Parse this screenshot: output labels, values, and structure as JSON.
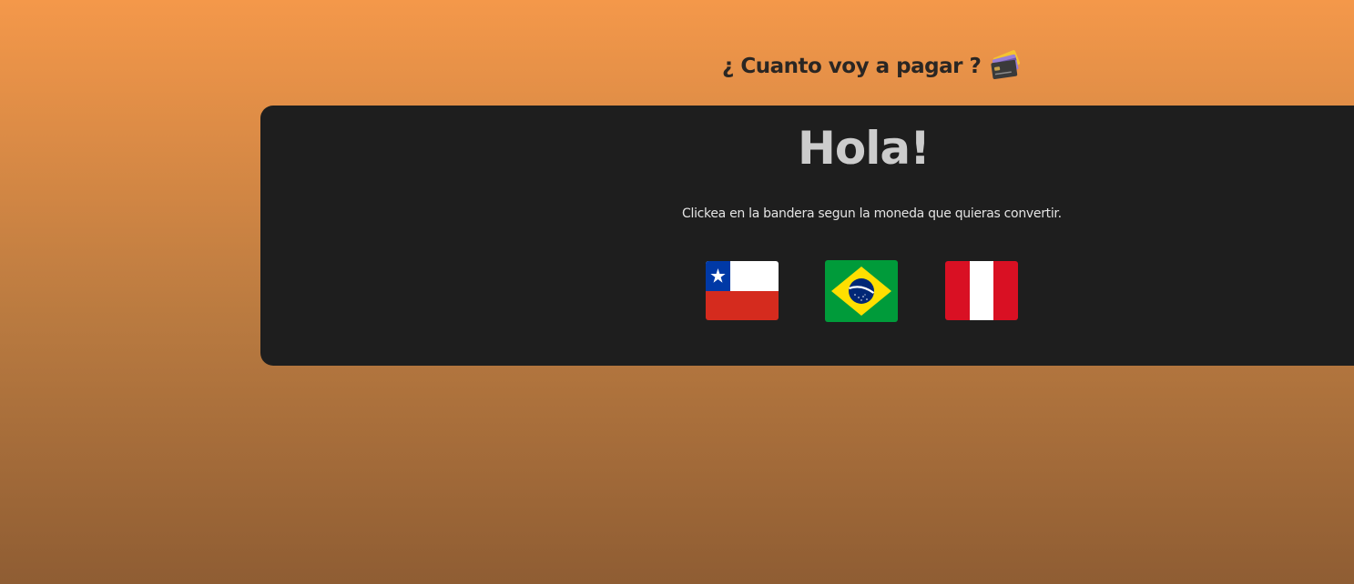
{
  "header": {
    "title": "¿ Cuanto voy a pagar ?",
    "icon": "credit-card-icon"
  },
  "main": {
    "greeting": "Hola!",
    "hint": "Clickea en la bandera segun la moneda que quieras convertir."
  },
  "flags": [
    {
      "name": "chile-flag",
      "icon": "flag-chile-icon"
    },
    {
      "name": "brazil-flag",
      "icon": "flag-brazil-icon"
    },
    {
      "name": "peru-flag",
      "icon": "flag-peru-icon"
    }
  ],
  "colors": {
    "background_top": "#f4984a",
    "background_bottom": "#8f5d33",
    "panel": "#1e1e1e",
    "greeting": "#cccccc"
  }
}
